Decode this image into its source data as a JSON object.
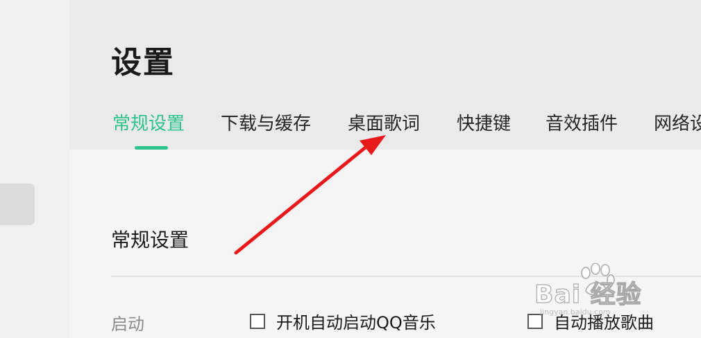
{
  "page": {
    "title": "设置"
  },
  "tabs": [
    {
      "label": "常规设置",
      "active": true
    },
    {
      "label": "下载与缓存",
      "active": false
    },
    {
      "label": "桌面歌词",
      "active": false
    },
    {
      "label": "快捷键",
      "active": false
    },
    {
      "label": "音效插件",
      "active": false
    },
    {
      "label": "网络设",
      "active": false
    }
  ],
  "section": {
    "title": "常规设置",
    "rows": [
      {
        "label": "启动",
        "options": [
          {
            "label": "开机自动启动QQ音乐",
            "checked": false
          },
          {
            "label": "自动播放歌曲",
            "checked": false
          }
        ]
      }
    ]
  },
  "watermark": {
    "text": "Bai 经验",
    "sub": "jingyan.baidu.com"
  },
  "colors": {
    "accent": "#2ec28d",
    "annotation_arrow": "#e8191b"
  }
}
